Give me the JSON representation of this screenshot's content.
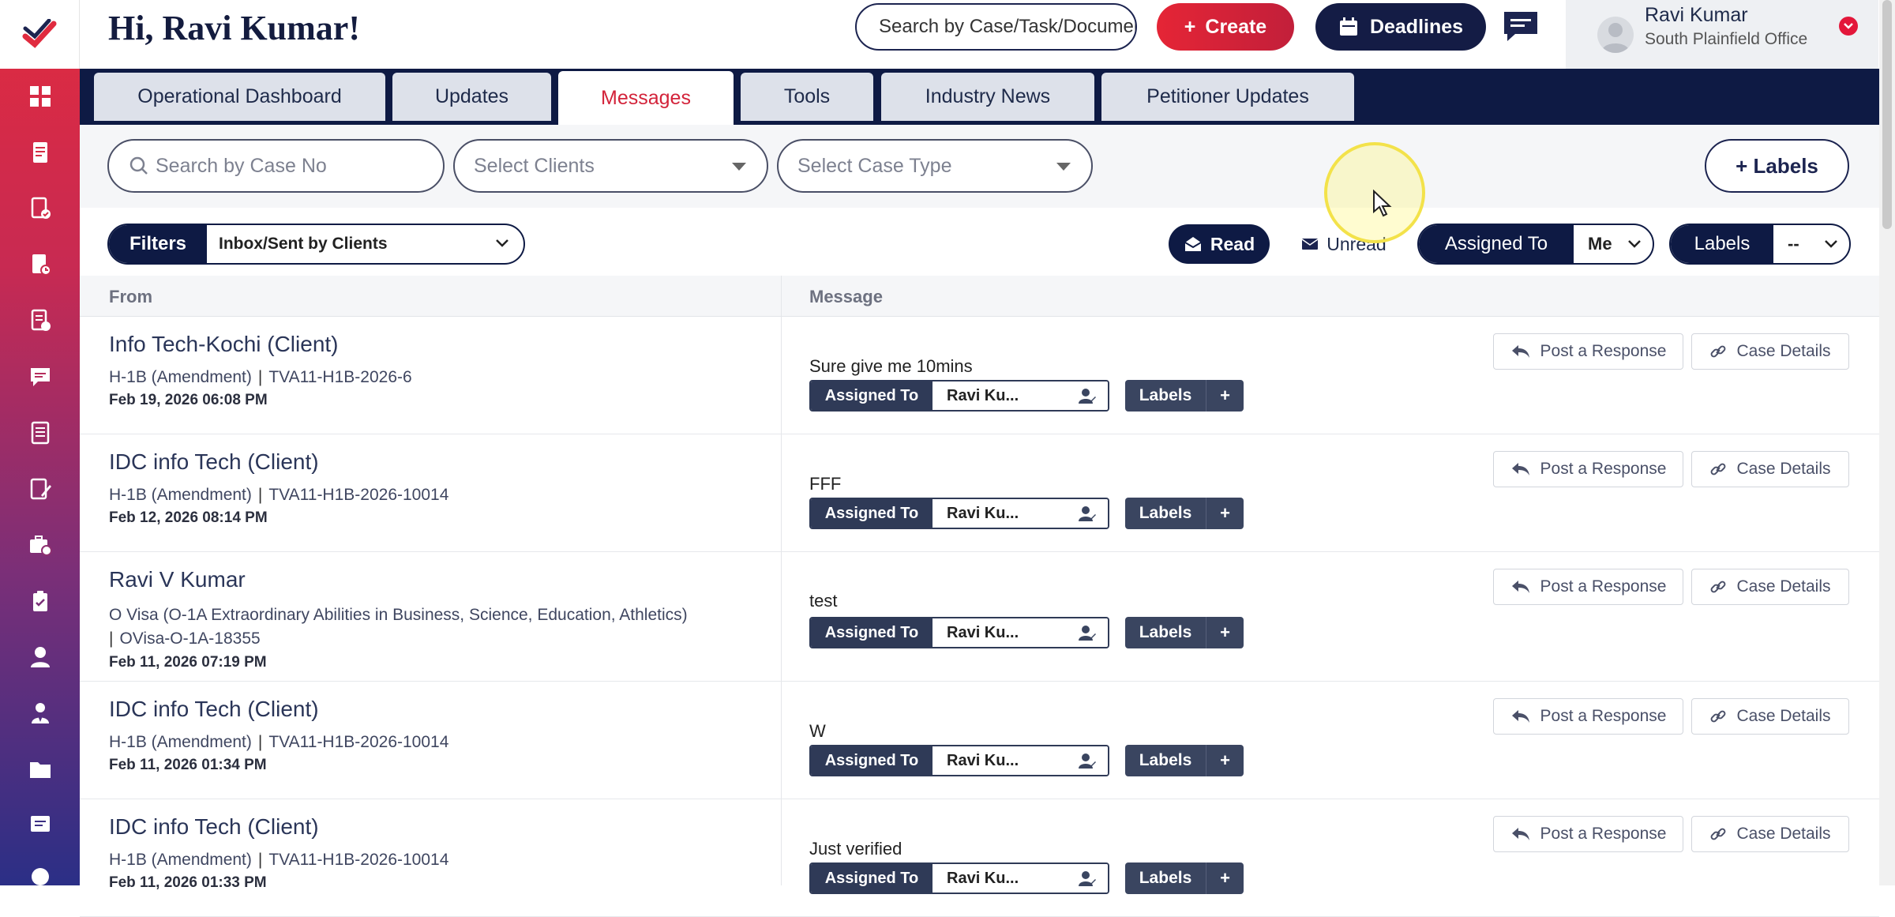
{
  "header": {
    "greeting": "Hi, Ravi Kumar!",
    "search_placeholder": "Search by Case/Task/Document",
    "create_label": "Create",
    "deadlines_label": "Deadlines",
    "user_name": "Ravi Kumar",
    "user_office": "South Plainfield Office"
  },
  "sidebar": {
    "icons": [
      "dashboard-icon",
      "document-icon",
      "document-check-icon",
      "document-clock-icon",
      "document-edit-icon",
      "chat-icon",
      "ledger-icon",
      "form-edit-icon",
      "briefcase-clock-icon",
      "clipboard-icon",
      "user-icon",
      "user-tie-icon",
      "folder-icon",
      "message-icon",
      "globe-icon"
    ]
  },
  "tabs": [
    {
      "label": "Operational Dashboard"
    },
    {
      "label": "Updates"
    },
    {
      "label": "Messages"
    },
    {
      "label": "Tools"
    },
    {
      "label": "Industry News"
    },
    {
      "label": "Petitioner Updates"
    }
  ],
  "filters": {
    "case_search_placeholder": "Search by Case No",
    "clients_placeholder": "Select Clients",
    "case_type_placeholder": "Select Case Type",
    "labels_button": "+ Labels",
    "filters_label": "Filters",
    "filters_value": "Inbox/Sent by Clients",
    "read_label": "Read",
    "unread_label": "Unread",
    "assigned_label": "Assigned To",
    "assigned_value": "Me",
    "labels_label": "Labels",
    "labels_value": "--"
  },
  "table": {
    "col_from": "From",
    "col_message": "Message",
    "assigned_to_label": "Assigned To",
    "labels_label": "Labels",
    "post_response_label": "Post a Response",
    "case_details_label": "Case Details",
    "rows": [
      {
        "from": "Info Tech-Kochi (Client)",
        "case_type": "H-1B (Amendment)",
        "case_no": "TVA11-H1B-2026-6",
        "date": "Feb 19, 2026 06:08 PM",
        "message": "Sure give me 10mins",
        "assignee": "Ravi Ku..."
      },
      {
        "from": "IDC info Tech (Client)",
        "case_type": "H-1B (Amendment)",
        "case_no": "TVA11-H1B-2026-10014",
        "date": "Feb 12, 2026 08:14 PM",
        "message": "FFF",
        "assignee": "Ravi Ku..."
      },
      {
        "from": "Ravi V Kumar",
        "case_type": "O Visa (O-1A Extraordinary Abilities in Business, Science, Education, Athletics)",
        "case_no": "OVisa-O-1A-18355",
        "date": "Feb 11, 2026 07:19 PM",
        "message": "test",
        "assignee": "Ravi Ku..."
      },
      {
        "from": "IDC info Tech (Client)",
        "case_type": "H-1B (Amendment)",
        "case_no": "TVA11-H1B-2026-10014",
        "date": "Feb 11, 2026 01:34 PM",
        "message": "W",
        "assignee": "Ravi Ku..."
      },
      {
        "from": "IDC info Tech (Client)",
        "case_type": "H-1B (Amendment)",
        "case_no": "TVA11-H1B-2026-10014",
        "date": "Feb 11, 2026 01:33 PM",
        "message": "Just verified",
        "assignee": "Ravi Ku..."
      }
    ]
  },
  "colors": {
    "brand_red": "#e52536",
    "navy": "#0e1a44"
  }
}
